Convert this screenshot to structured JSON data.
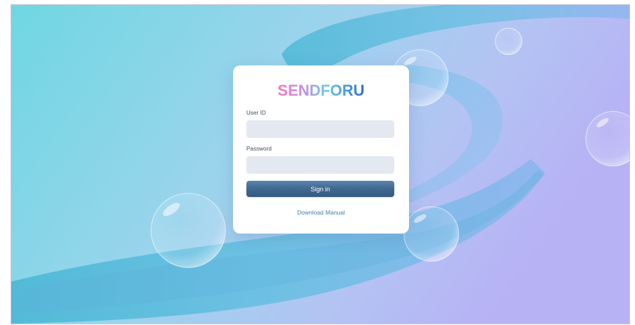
{
  "brand": {
    "name": "SENDFORU",
    "colors": {
      "accent_gradient": [
        "#f07ab8",
        "#b58cf0",
        "#59c9e8",
        "#2f7fd0"
      ],
      "button": "#3f6790",
      "link": "#3f7fb0",
      "background": [
        "#6fd6e3",
        "#b9c2f5"
      ]
    }
  },
  "login": {
    "user_id_label": "User ID",
    "user_id_value": "",
    "password_label": "Password",
    "password_value": "",
    "sign_in_label": "Sign in",
    "download_manual_label": "Download Manual"
  }
}
